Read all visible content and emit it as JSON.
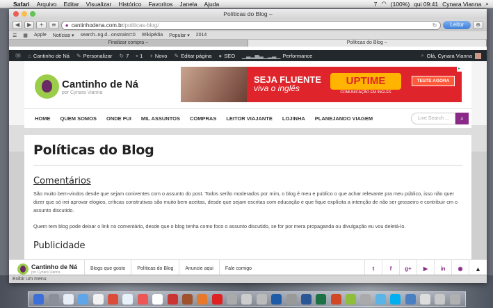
{
  "menubar": {
    "app": "Safari",
    "items": [
      "Arquivo",
      "Editar",
      "Visualizar",
      "Histórico",
      "Favoritos",
      "Janela",
      "Ajuda"
    ],
    "battery": "(100%)",
    "clock": "qui 09:41",
    "user": "Cynara Vianna",
    "status_count": "7"
  },
  "browser": {
    "window_title": "Políticas do Blog –",
    "url_host": "cantinhodena.com.br",
    "url_path": "/politicas-blog/",
    "reader_label": "Leitor",
    "bookmarks": [
      "Apple",
      "Notícias ▾",
      "search–ng.d...onstraint=0",
      "Wikipédia",
      "Popular ▾",
      "2014"
    ],
    "tabs": [
      {
        "label": "Finalizar compra –",
        "active": false
      },
      {
        "label": "Políticas do Blog –",
        "active": true
      }
    ],
    "status_text": "Exibir um menu"
  },
  "wpadmin": {
    "items": [
      {
        "icon": "wordpress-icon",
        "label": ""
      },
      {
        "icon": "home-icon",
        "label": "Cantinho de Ná"
      },
      {
        "icon": "brush-icon",
        "label": "Personalizar"
      },
      {
        "icon": "refresh-icon",
        "label": "7"
      },
      {
        "icon": "comment-icon",
        "label": "1"
      },
      {
        "icon": "plus-icon",
        "label": "Novo"
      },
      {
        "icon": "pencil-icon",
        "label": "Editar página"
      },
      {
        "icon": "dot-icon",
        "label": "SEO"
      },
      {
        "icon": "graph-icon",
        "label": "Performance"
      }
    ],
    "greeting": "Olá, Cynara Vianna"
  },
  "site": {
    "logo_name": "Cantinho de Ná",
    "logo_sub": "por Cynara Vianna",
    "banner": {
      "slogan_1": "SEJA FLUENTE",
      "slogan_2": "viva o inglês",
      "brand": "UPTIME",
      "brand_sub": "COMUNICAÇÃO EM INGLÊS",
      "cta": "TESTE AGORA"
    },
    "nav": [
      "HOME",
      "QUEM SOMOS",
      "ONDE FUI",
      "MIL ASSUNTOS",
      "COMPRAS",
      "LEITOR VIAJANTE",
      "LOJINHA",
      "PLANEJANDO VIAGEM"
    ],
    "search_placeholder": "Live Search ...",
    "page_title": "Políticas do Blog",
    "section_1": "Comentários",
    "para_1": "São muito bem-vindos desde que sejam coniventes com o assunto do post. Todos serão moderados por mim, o blog é meu e publico o que achar relevante pra meu público, isso não quer dizer que só irei aprovar elogios, críticas construtivas são muito bem aceitas, desde que sejam escritas com educação e que fique explícita a intenção de não ser grosseiro e contribuir cm o assunto discutido.",
    "para_2": "Quem tem blog pode deixar o link no comentário, desde que o blog tenha como foco o assunto discutido, se for por mera propaganda ou divulgação eu vou deletá-lo.",
    "section_2": "Publicidade",
    "footer_links": [
      "Blogs que gosto",
      "Políticas do Blog",
      "Anuncie aqui",
      "Fale comigo"
    ],
    "social": [
      {
        "icon": "twitter-icon",
        "glyph": "t"
      },
      {
        "icon": "facebook-icon",
        "glyph": "f"
      },
      {
        "icon": "googleplus-icon",
        "glyph": "g+"
      },
      {
        "icon": "youtube-icon",
        "glyph": "▶"
      },
      {
        "icon": "linkedin-icon",
        "glyph": "in"
      },
      {
        "icon": "rss-icon",
        "glyph": "◉"
      }
    ]
  },
  "colors": {
    "brand_purple": "#8a2a88",
    "wp_bar": "#23282d",
    "banner_red": "#e0242b",
    "uptime_yellow": "#ffb400"
  }
}
